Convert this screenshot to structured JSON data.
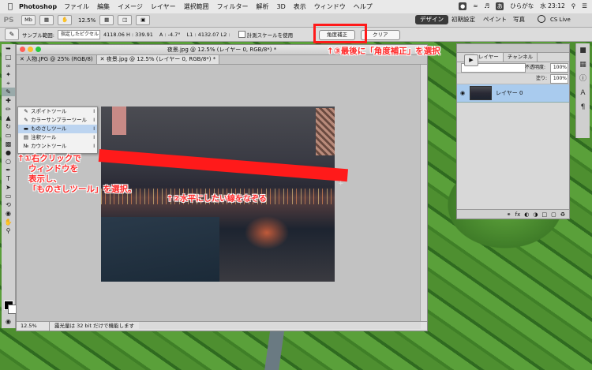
{
  "menubar": {
    "app": "Photoshop",
    "items": [
      "ファイル",
      "編集",
      "イメージ",
      "レイヤー",
      "選択範囲",
      "フィルター",
      "解析",
      "3D",
      "表示",
      "ウィンドウ",
      "ヘルプ"
    ],
    "ime": "ひらがな",
    "clock": "水 23:12"
  },
  "appbar": {
    "logo": "PS",
    "mb": "Mb",
    "zoom": "12.5%",
    "workspaces": [
      "デザイン",
      "初期設定",
      "ペイント",
      "写真"
    ],
    "cslive": "CS Live"
  },
  "options": {
    "sample_label": "サンプル範囲:",
    "sample_value": "指定したピクセル",
    "xy": "4118.06 H : 339.91",
    "angle": "A : -4.7°",
    "length": "L1 : 4132.07 L2 :",
    "scale_label": "計測スケールを使用",
    "straighten_button": "角度補正",
    "clear_button": "クリア"
  },
  "document": {
    "window_title": "夜景.jpg @ 12.5% (レイヤー 0, RGB/8*) *",
    "tabs": [
      "人物.JPG @ 25% (RGB/8)",
      "夜景.jpg @ 12.5% (レイヤー 0, RGB/8*) *"
    ],
    "status_zoom": "12.5%",
    "status_info": "露光量は 32 bit だけで機能します"
  },
  "context_menu": {
    "items": [
      {
        "label": "スポイトツール",
        "shortcut": "I"
      },
      {
        "label": "カラーサンプラーツール",
        "shortcut": "I"
      },
      {
        "label": "ものさしツール",
        "shortcut": "I"
      },
      {
        "label": "注釈ツール",
        "shortcut": "I"
      },
      {
        "label": "カウントツール",
        "shortcut": "I"
      }
    ]
  },
  "layers_panel": {
    "tabs": [
      "レイヤー",
      "チャンネル"
    ],
    "opacity_label": "不透明度:",
    "opacity_value": "100%",
    "fill_label": "塗り:",
    "fill_value": "100%",
    "layer_name": "レイヤー 0",
    "footer_icons": [
      "link-icon",
      "fx-icon",
      "mask-icon",
      "adjustment-icon",
      "folder-icon",
      "new-layer-icon",
      "trash-icon"
    ]
  },
  "annotations": {
    "step1_line1": "↑①右クリックで",
    "step1_line2": "ウィンドウを",
    "step1_line3": "表示し、",
    "step1_line4": "「ものさしツール」を選択。",
    "step2": "↑②水平にしたい線をなぞる",
    "step3": "↑③最後に「角度補正」を選択"
  },
  "colors": {
    "annotation": "#ff1a1a",
    "selected_layer": "#a9cbee"
  }
}
